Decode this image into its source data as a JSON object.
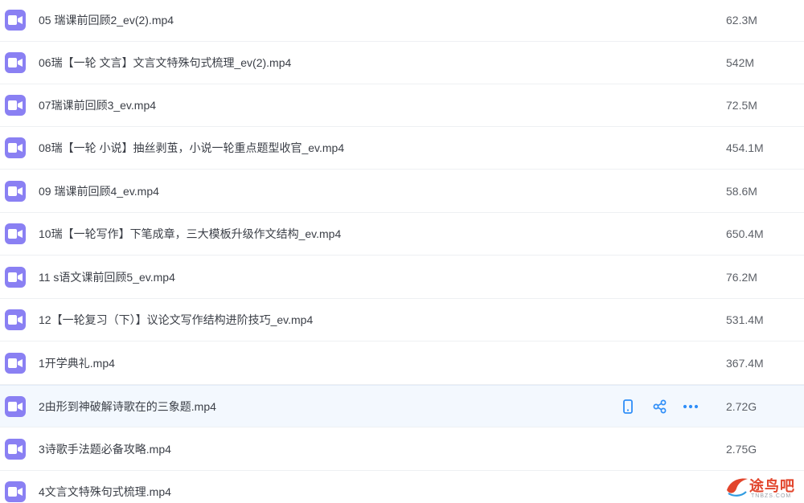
{
  "colors": {
    "file_icon_bg": "#8a80f3",
    "action_icon": "#2f8ef8",
    "hover_row_bg": "#f3f8fe",
    "watermark": "#e2452c"
  },
  "files": [
    {
      "name": "05 瑞课前回顾2_ev(2).mp4",
      "size": "62.3M",
      "icon": "video-icon"
    },
    {
      "name": "06瑞【一轮 文言】文言文特殊句式梳理_ev(2).mp4",
      "size": "542M",
      "icon": "video-icon"
    },
    {
      "name": "07瑞课前回顾3_ev.mp4",
      "size": "72.5M",
      "icon": "video-icon"
    },
    {
      "name": "08瑞【一轮 小说】抽丝剥茧，小说一轮重点题型收官_ev.mp4",
      "size": "454.1M",
      "icon": "video-icon"
    },
    {
      "name": "09 瑞课前回顾4_ev.mp4",
      "size": "58.6M",
      "icon": "video-icon"
    },
    {
      "name": "10瑞【一轮写作】下笔成章，三大模板升级作文结构_ev.mp4",
      "size": "650.4M",
      "icon": "video-icon"
    },
    {
      "name": "11 s语文课前回顾5_ev.mp4",
      "size": "76.2M",
      "icon": "video-icon"
    },
    {
      "name": "12【一轮复习（下）】议论文写作结构进阶技巧_ev.mp4",
      "size": "531.4M",
      "icon": "video-icon"
    },
    {
      "name": "1开学典礼.mp4",
      "size": "367.4M",
      "icon": "video-icon"
    },
    {
      "name": "2由形到神破解诗歌在的三象题.mp4",
      "size": "2.72G",
      "icon": "video-icon",
      "hovered": true
    },
    {
      "name": "3诗歌手法题必备攻略.mp4",
      "size": "2.75G",
      "icon": "video-icon"
    },
    {
      "name": "4文言文特殊句式梳理.mp4",
      "size": "",
      "icon": "video-icon"
    }
  ],
  "hover_actions": [
    {
      "icon": "phone-icon",
      "label": "mobile"
    },
    {
      "icon": "share-icon",
      "label": "share"
    },
    {
      "icon": "more-icon",
      "label": "more"
    }
  ],
  "watermark": {
    "text": "途鸟吧",
    "sub": "TNBZS.COM"
  }
}
